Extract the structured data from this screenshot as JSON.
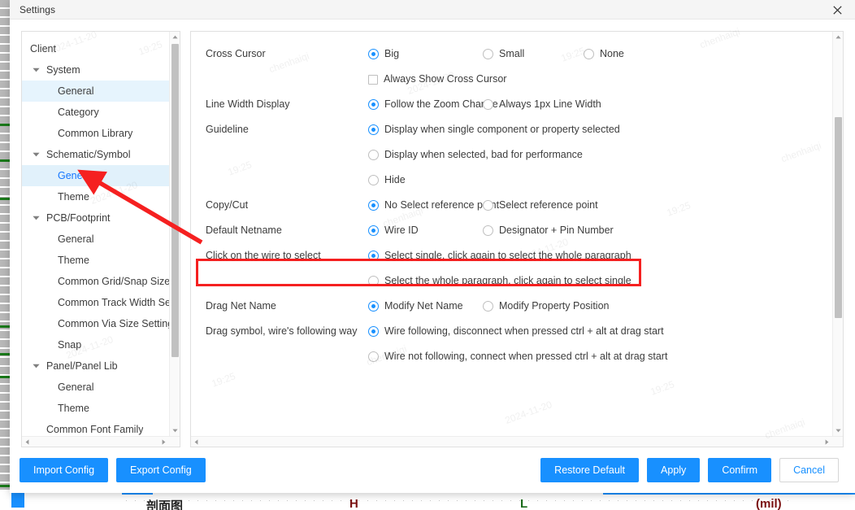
{
  "window": {
    "title": "Settings",
    "close_icon": "close-icon"
  },
  "sidebar": {
    "items": [
      {
        "label": "Client",
        "level": 0,
        "caret": false,
        "state": "normal"
      },
      {
        "label": "System",
        "level": 1,
        "caret": true,
        "state": "normal"
      },
      {
        "label": "General",
        "level": 2,
        "caret": false,
        "state": "hovered"
      },
      {
        "label": "Category",
        "level": 2,
        "caret": false,
        "state": "normal"
      },
      {
        "label": "Common Library",
        "level": 2,
        "caret": false,
        "state": "normal"
      },
      {
        "label": "Schematic/Symbol",
        "level": 1,
        "caret": true,
        "state": "normal"
      },
      {
        "label": "General",
        "level": 2,
        "caret": false,
        "state": "selected"
      },
      {
        "label": "Theme",
        "level": 2,
        "caret": false,
        "state": "normal"
      },
      {
        "label": "PCB/Footprint",
        "level": 1,
        "caret": true,
        "state": "normal"
      },
      {
        "label": "General",
        "level": 2,
        "caret": false,
        "state": "normal"
      },
      {
        "label": "Theme",
        "level": 2,
        "caret": false,
        "state": "normal"
      },
      {
        "label": "Common Grid/Snap Size Setting",
        "level": 2,
        "caret": false,
        "state": "normal"
      },
      {
        "label": "Common Track Width Setting",
        "level": 2,
        "caret": false,
        "state": "normal"
      },
      {
        "label": "Common Via Size Setting",
        "level": 2,
        "caret": false,
        "state": "normal"
      },
      {
        "label": "Snap",
        "level": 2,
        "caret": false,
        "state": "normal"
      },
      {
        "label": "Panel/Panel Lib",
        "level": 1,
        "caret": true,
        "state": "normal"
      },
      {
        "label": "General",
        "level": 2,
        "caret": false,
        "state": "normal"
      },
      {
        "label": "Theme",
        "level": 2,
        "caret": false,
        "state": "normal"
      },
      {
        "label": "Common Font Family",
        "level": 1,
        "caret": false,
        "state": "normal"
      }
    ]
  },
  "options": [
    {
      "label": "Cross Cursor",
      "lines": [
        {
          "type": "radios",
          "items": [
            {
              "text": "Big",
              "checked": true,
              "col": "col-a"
            },
            {
              "text": "Small",
              "checked": false,
              "col": "col-b"
            },
            {
              "text": "None",
              "checked": false,
              "col": "w-auto"
            }
          ]
        },
        {
          "type": "checkbox",
          "items": [
            {
              "text": "Always Show Cross Cursor",
              "checked": false
            }
          ]
        }
      ]
    },
    {
      "label": "Line Width Display",
      "lines": [
        {
          "type": "radios",
          "items": [
            {
              "text": "Follow the Zoom Change",
              "checked": true,
              "col": "col-a"
            },
            {
              "text": "Always 1px Line Width",
              "checked": false,
              "col": "w-auto"
            }
          ]
        }
      ]
    },
    {
      "label": "Guideline",
      "lines": [
        {
          "type": "radios",
          "items": [
            {
              "text": "Display when single component or property selected",
              "checked": true,
              "col": "w-auto"
            }
          ]
        },
        {
          "type": "radios",
          "items": [
            {
              "text": "Display when selected, bad for performance",
              "checked": false,
              "col": "w-auto"
            }
          ]
        },
        {
          "type": "radios",
          "items": [
            {
              "text": "Hide",
              "checked": false,
              "col": "w-auto"
            }
          ]
        }
      ]
    },
    {
      "label": "Copy/Cut",
      "lines": [
        {
          "type": "radios",
          "items": [
            {
              "text": "No Select reference point",
              "checked": true,
              "col": "col-a"
            },
            {
              "text": "Select reference point",
              "checked": false,
              "col": "w-auto"
            }
          ]
        }
      ]
    },
    {
      "label": "Default Netname",
      "highlighted": true,
      "lines": [
        {
          "type": "radios",
          "items": [
            {
              "text": "Wire ID",
              "checked": true,
              "col": "col-a"
            },
            {
              "text": "Designator + Pin Number",
              "checked": false,
              "col": "w-auto"
            }
          ]
        }
      ]
    },
    {
      "label": "Click on the wire to select",
      "lines": [
        {
          "type": "radios",
          "items": [
            {
              "text": "Select single, click again to select the whole paragraph",
              "checked": true,
              "col": "w-auto"
            }
          ]
        },
        {
          "type": "radios",
          "items": [
            {
              "text": "Select the whole paragraph, click again to select single",
              "checked": false,
              "col": "w-auto"
            }
          ]
        }
      ]
    },
    {
      "label": "Drag Net Name",
      "lines": [
        {
          "type": "radios",
          "items": [
            {
              "text": "Modify Net Name",
              "checked": true,
              "col": "col-a"
            },
            {
              "text": "Modify Property Position",
              "checked": false,
              "col": "w-auto"
            }
          ]
        }
      ]
    },
    {
      "label": "Drag symbol, wire's following way",
      "lines": [
        {
          "type": "radios",
          "items": [
            {
              "text": "Wire following, disconnect when pressed ctrl + alt at drag start",
              "checked": true,
              "col": "w-auto"
            }
          ]
        },
        {
          "type": "radios",
          "items": [
            {
              "text": "Wire not following, connect when pressed ctrl + alt at drag start",
              "checked": false,
              "col": "w-auto"
            }
          ]
        }
      ]
    }
  ],
  "footer": {
    "left_buttons": [
      "Import Config",
      "Export Config"
    ],
    "right_buttons": [
      {
        "label": "Restore Default",
        "style": "primary"
      },
      {
        "label": "Apply",
        "style": "primary"
      },
      {
        "label": "Confirm",
        "style": "primary"
      },
      {
        "label": "Cancel",
        "style": "ghost"
      }
    ]
  },
  "colors": {
    "accent": "#1890ff",
    "highlight": "#f52020",
    "selected_row": "#e1f1fb",
    "titlebar": "#f5f5f5"
  },
  "watermarks": [
    "2024-11-20",
    "19:25",
    "chenhaiqi",
    "2024-11-20",
    "19:25",
    "chenhaiqi",
    "2024-11-20",
    "19:25",
    "chenhaiqi",
    "2024-11-20",
    "19:25",
    "chenhaiqi",
    "2024-11-20",
    "19:25",
    "chenhaiqi",
    "2024-11-20",
    "19:25",
    "chenhaiqi"
  ],
  "background_fragments": [
    "剖面图",
    "H",
    "L",
    "(mil)"
  ]
}
